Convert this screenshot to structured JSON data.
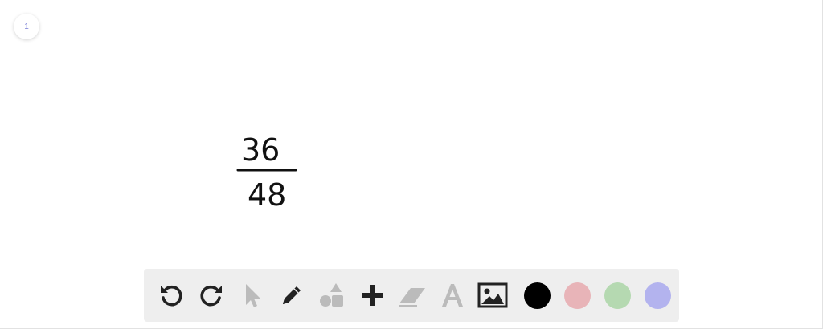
{
  "page": {
    "number": "1"
  },
  "whiteboard": {
    "numerator": "36",
    "denominator": "48"
  },
  "toolbar": {
    "tools": [
      {
        "name": "undo",
        "icon": "undo-icon",
        "enabled": true
      },
      {
        "name": "redo",
        "icon": "redo-icon",
        "enabled": true
      },
      {
        "name": "select",
        "icon": "cursor-arrow-icon",
        "enabled": false
      },
      {
        "name": "pen",
        "icon": "pencil-icon",
        "enabled": true
      },
      {
        "name": "shapes",
        "icon": "shapes-icon",
        "enabled": false
      },
      {
        "name": "add",
        "icon": "plus-icon",
        "enabled": true
      },
      {
        "name": "eraser",
        "icon": "eraser-icon",
        "enabled": false
      },
      {
        "name": "text",
        "icon": "text-icon",
        "enabled": false
      },
      {
        "name": "image",
        "icon": "image-icon",
        "enabled": true
      }
    ],
    "colors": {
      "black": "#000000",
      "red": "#e8b4b8",
      "green": "#b5d9b1",
      "purple": "#b3b3ee"
    },
    "icon_active": "#222222",
    "icon_disabled": "#bbbbbb"
  }
}
